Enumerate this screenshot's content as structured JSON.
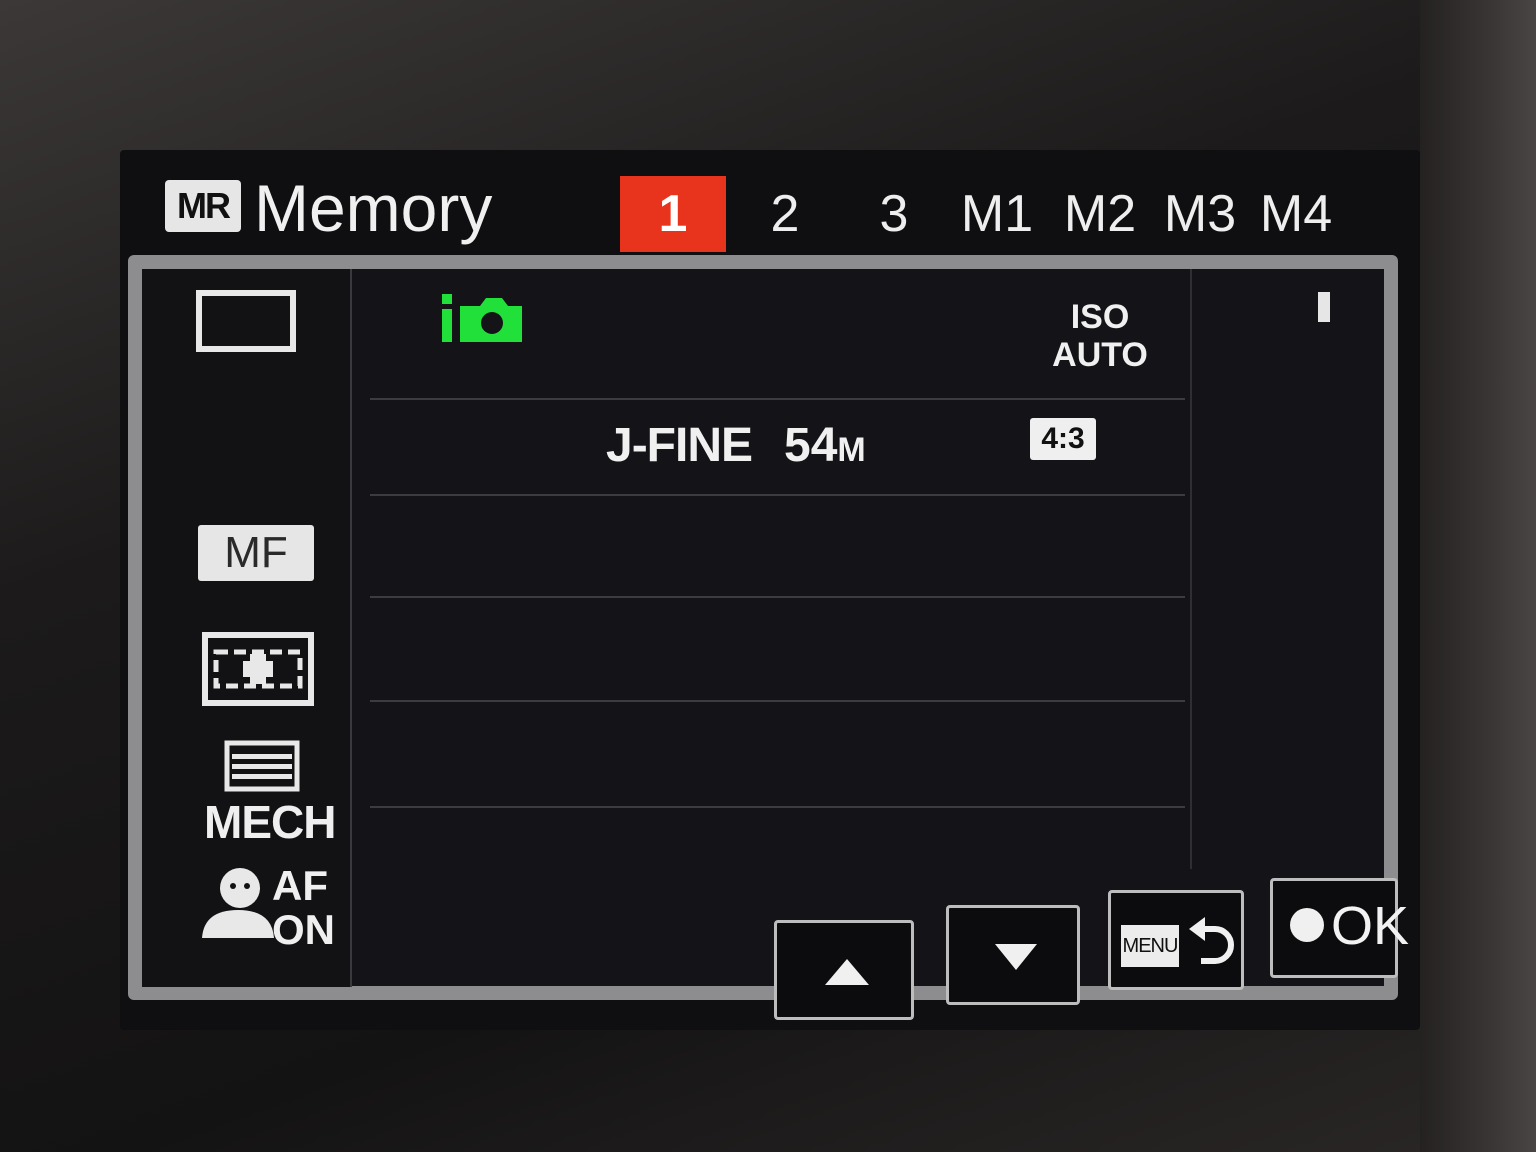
{
  "header": {
    "badge": "MR",
    "title": "Memory",
    "tabs": [
      {
        "label": "1",
        "active": true
      },
      {
        "label": "2",
        "active": false
      },
      {
        "label": "3",
        "active": false
      },
      {
        "label": "M1",
        "active": false
      },
      {
        "label": "M2",
        "active": false
      },
      {
        "label": "M3",
        "active": false
      },
      {
        "label": "M4",
        "active": false
      }
    ]
  },
  "left_icons": {
    "frame_icon": "single-frame-drive-icon",
    "mf": "MF",
    "metering_icon": "metering-mode-icon",
    "mech_icon": "shutter-type-icon",
    "mech": "MECH",
    "af_on_icon": "face-detect-icon",
    "af": "AF",
    "on": "ON"
  },
  "settings": {
    "mode_icon": "intelligent-auto-icon",
    "mode_color": "#22e03a",
    "iso_line1": "ISO",
    "iso_line2": "AUTO",
    "quality": "J-FINE",
    "size_number": "54",
    "size_unit": "M",
    "aspect": "4:3"
  },
  "buttons": {
    "up_icon": "arrow-up-icon",
    "down_icon": "arrow-down-icon",
    "menu_badge": "MENU",
    "back_icon": "return-arrow-icon",
    "ok_label": "OK"
  },
  "colors": {
    "active_tab": "#e8341c",
    "mode_icon_green": "#22e03a"
  }
}
